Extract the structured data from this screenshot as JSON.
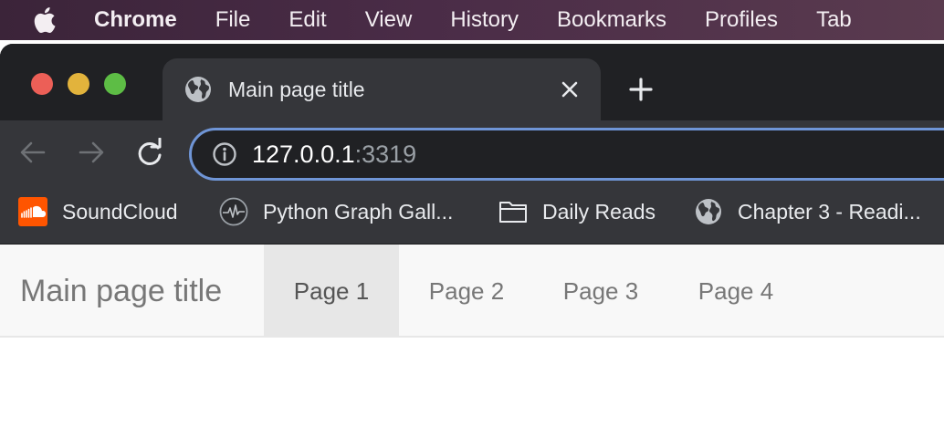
{
  "menubar": {
    "app_name": "Chrome",
    "items": [
      "File",
      "Edit",
      "View",
      "History",
      "Bookmarks",
      "Profiles",
      "Tab"
    ]
  },
  "tab": {
    "title": "Main page title",
    "icon": "globe-icon"
  },
  "toolbar": {
    "url_host": "127.0.0.1",
    "url_port": ":3319"
  },
  "bookmarks": [
    {
      "label": "SoundCloud",
      "icon": "soundcloud-icon"
    },
    {
      "label": "Python Graph Gall...",
      "icon": "graph-gallery-icon"
    },
    {
      "label": "Daily Reads",
      "icon": "folder-icon"
    },
    {
      "label": "Chapter 3 - Readi...",
      "icon": "globe-icon"
    }
  ],
  "page": {
    "brand": "Main page title",
    "nav": [
      {
        "label": "Page 1",
        "active": true
      },
      {
        "label": "Page 2",
        "active": false
      },
      {
        "label": "Page 3",
        "active": false
      },
      {
        "label": "Page 4",
        "active": false
      }
    ]
  },
  "colors": {
    "accent_focus": "#6f95d6",
    "traffic_close": "#ec5f57",
    "traffic_minimize": "#e2b33c",
    "traffic_maximize": "#5dbd45",
    "soundcloud": "#ff5500"
  }
}
